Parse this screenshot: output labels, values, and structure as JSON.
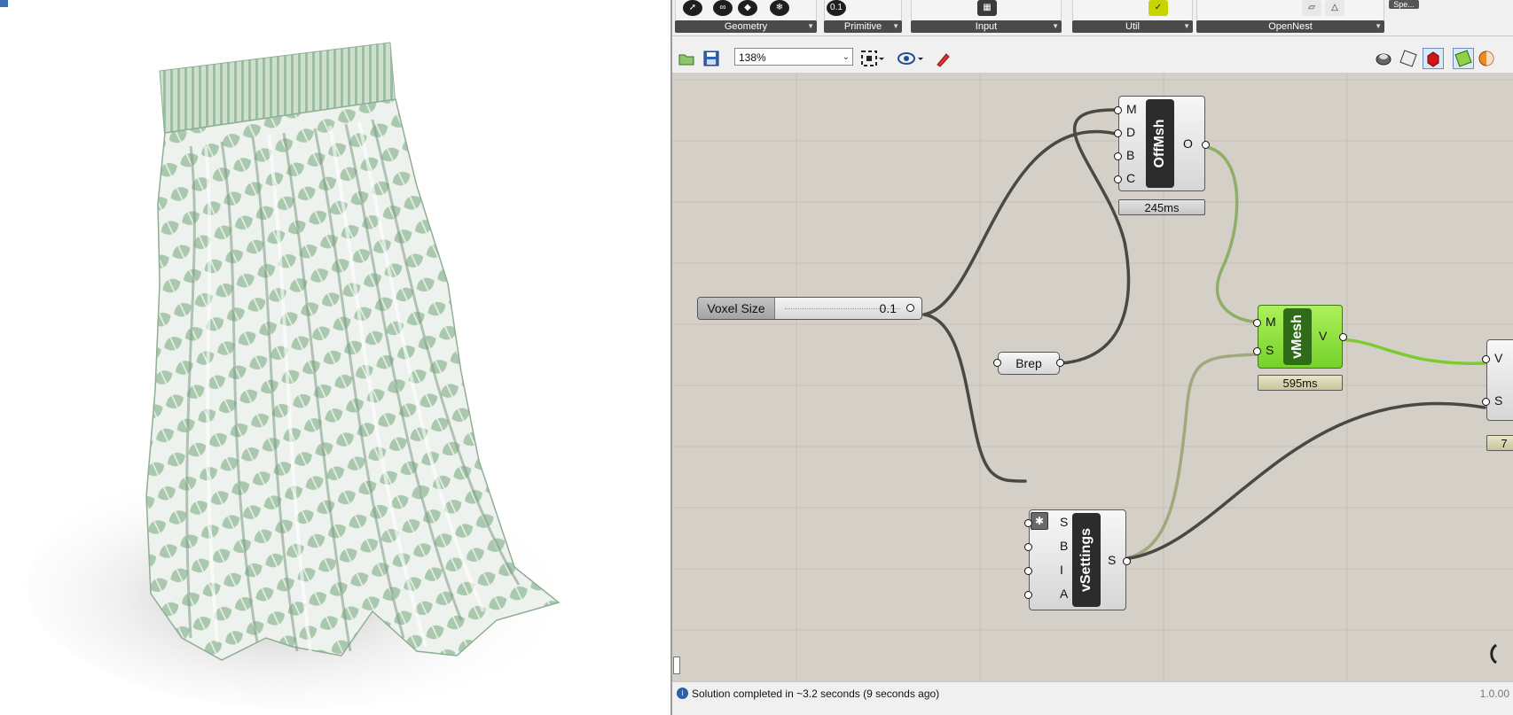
{
  "ribbon": {
    "groups": [
      {
        "label": "Geometry"
      },
      {
        "label": "Primitive"
      },
      {
        "label": "Input"
      },
      {
        "label": "Util"
      },
      {
        "label": "OpenNest"
      }
    ],
    "primitive_icon_text": "0.1",
    "partial_tab": "Spe..."
  },
  "toolbar": {
    "zoom": "138%"
  },
  "canvas": {
    "slider": {
      "label": "Voxel Size",
      "value": "0.1"
    },
    "brep": {
      "label": "Brep"
    },
    "offmsh": {
      "name": "OffMsh",
      "inputs": [
        "M",
        "D",
        "B",
        "C"
      ],
      "outputs": [
        "O"
      ],
      "timer": "245ms"
    },
    "vmesh": {
      "name": "vMesh",
      "inputs": [
        "M",
        "S"
      ],
      "outputs": [
        "V"
      ],
      "timer": "595ms"
    },
    "vsettings": {
      "name": "vSettings",
      "inputs": [
        "S",
        "B",
        "I",
        "A"
      ],
      "outputs": [
        "S"
      ]
    },
    "partial_comp": {
      "inputs": [
        "V",
        "S"
      ],
      "timer": "7"
    }
  },
  "status": {
    "text": "Solution completed in ~3.2 seconds (9 seconds ago)",
    "version": "1.0.00"
  },
  "colors": {
    "canvas": "#d4d0c8",
    "wire_dark": "#4a4844",
    "wire_green": "#7ccc30",
    "component_green": "#8ee23c",
    "cloth_green": "#a9c8ad"
  }
}
